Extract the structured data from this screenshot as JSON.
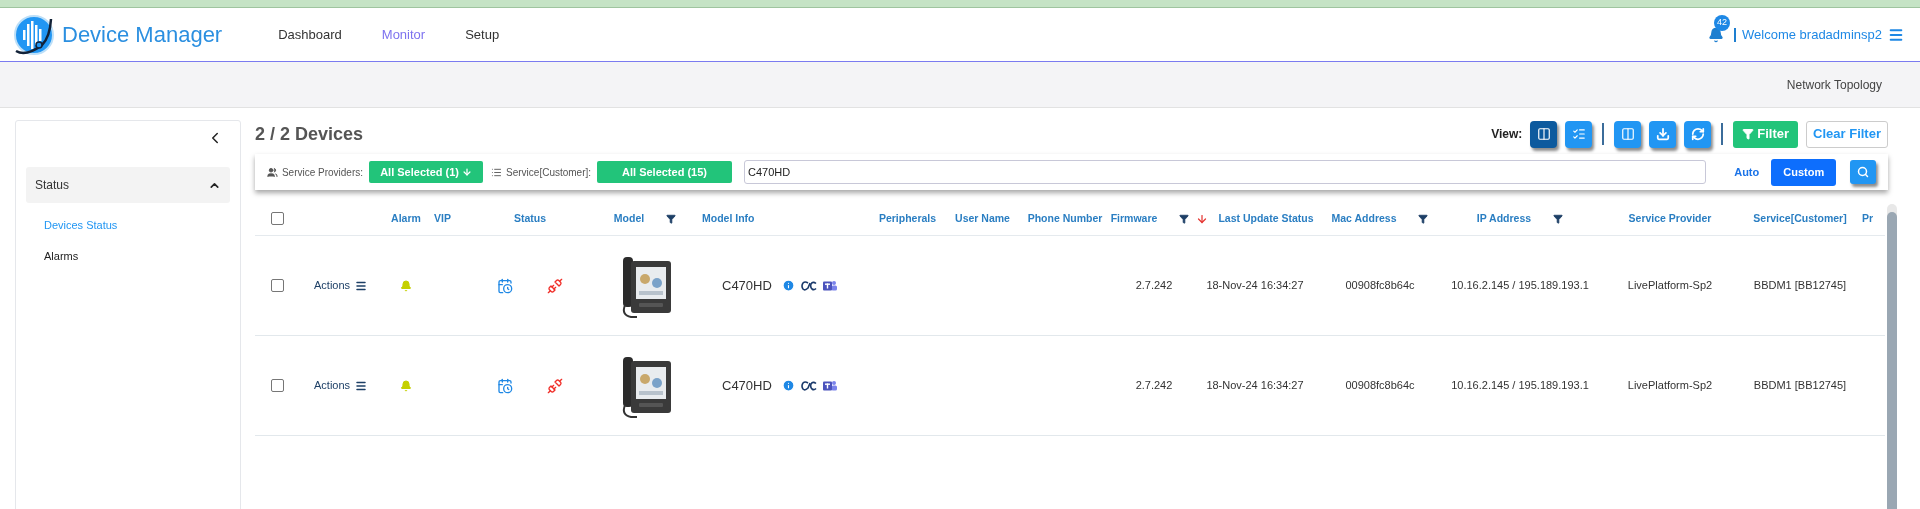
{
  "app": {
    "title": "Device Manager"
  },
  "nav": [
    {
      "label": "Dashboard",
      "selected": false
    },
    {
      "label": "Monitor",
      "selected": true
    },
    {
      "label": "Setup",
      "selected": false
    }
  ],
  "notifications": {
    "count": "42"
  },
  "user": {
    "greeting": "Welcome bradadminsp2"
  },
  "subbar": {
    "link": "Network Topology"
  },
  "sidebar": {
    "sections": [
      {
        "label": "Status",
        "expanded": true,
        "children": [
          {
            "label": "Devices Status",
            "selected": true
          },
          {
            "label": "Alarms",
            "selected": false
          }
        ]
      }
    ]
  },
  "main": {
    "heading": "2 / 2 Devices",
    "view_label": "View:",
    "view_modes": [
      {
        "kind": "tree",
        "selected": true
      },
      {
        "kind": "list",
        "selected": false
      }
    ],
    "filter_button": "Filter",
    "clear_filter": "Clear Filter"
  },
  "filters": {
    "providers_label": "Service Providers:",
    "providers_value": "All Selected (1)",
    "customer_label": "Service[Customer]:",
    "customer_value": "All Selected (15)",
    "search_value": "C470HD",
    "modes": [
      {
        "label": "Auto",
        "selected": false
      },
      {
        "label": "Custom",
        "selected": true
      }
    ]
  },
  "table": {
    "columns": [
      {
        "kind": "checkbox",
        "checked": false
      },
      {
        "kind": "blank"
      },
      {
        "kind": "text",
        "label": "Alarm",
        "filter": false
      },
      {
        "kind": "text",
        "label": "VIP",
        "filter": false
      },
      {
        "kind": "text",
        "label": "Status",
        "filter": false
      },
      {
        "kind": "text",
        "label": "Model",
        "filter": true
      },
      {
        "kind": "text",
        "label": "Model Info",
        "filter": false
      },
      {
        "kind": "text",
        "label": "Peripherals",
        "filter": false
      },
      {
        "kind": "text",
        "label": "User Name",
        "filter": false
      },
      {
        "kind": "text",
        "label": "Phone Number",
        "filter": false
      },
      {
        "kind": "text",
        "label": "Firmware",
        "filter": true
      },
      {
        "kind": "text",
        "label": "Last Update Status",
        "filter": false,
        "sorted": true
      },
      {
        "kind": "text",
        "label": "Mac Address",
        "filter": true
      },
      {
        "kind": "text",
        "label": "IP Address",
        "filter": true
      },
      {
        "kind": "text",
        "label": "Service Provider",
        "filter": false
      },
      {
        "kind": "text",
        "label": "Service[Customer]",
        "filter": false
      },
      {
        "kind": "text",
        "label": "Pr",
        "filter": false
      }
    ],
    "rows": [
      {
        "checked": false,
        "actions": "Actions",
        "connected": false,
        "model": "C470HD",
        "firmware": "2.7.242",
        "last_update": "18-Nov-24 16:34:27",
        "mac": "00908fc8b64c",
        "ip": "10.16.2.145 / 195.189.193.1",
        "service_provider": "LivePlatform-Sp2",
        "service_customer": "BBDM1 [BB12745]"
      },
      {
        "checked": false,
        "actions": "Actions",
        "connected": false,
        "model": "C470HD",
        "firmware": "2.7.242",
        "last_update": "18-Nov-24 16:34:27",
        "mac": "00908fc8b64c",
        "ip": "10.16.2.145 / 195.189.193.1",
        "service_provider": "LivePlatform-Sp2",
        "service_customer": "BBDM1 [BB12745]"
      }
    ]
  }
}
